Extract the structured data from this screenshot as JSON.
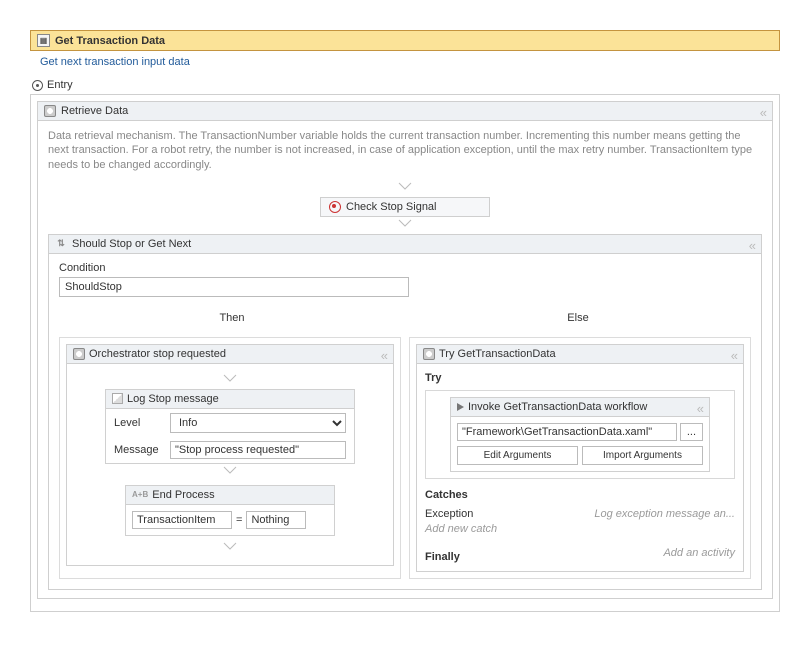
{
  "header": {
    "title": "Get Transaction Data",
    "subtitle": "Get next transaction input data"
  },
  "entry_label": "Entry",
  "retrieve": {
    "title": "Retrieve Data",
    "description": "Data retrieval mechanism. The TransactionNumber variable holds the current transaction number. Incrementing this number means getting the next transaction. For a robot retry, the number is not increased, in case of application exception, until the max retry number. TransactionItem type needs to be changed accordingly."
  },
  "check_stop": {
    "label": "Check Stop Signal"
  },
  "should_stop": {
    "title": "Should Stop or Get Next",
    "condition_label": "Condition",
    "condition_value": "ShouldStop",
    "then_label": "Then",
    "else_label": "Else"
  },
  "then_branch": {
    "title": "Orchestrator stop requested",
    "log": {
      "title": "Log Stop message",
      "level_label": "Level",
      "level_value": "Info",
      "message_label": "Message",
      "message_value": "\"Stop process requested\""
    },
    "assign": {
      "title": "End Process",
      "left": "TransactionItem",
      "op": "=",
      "right": "Nothing"
    }
  },
  "else_branch": {
    "title": "Try GetTransactionData",
    "try_label": "Try",
    "invoke": {
      "title": "Invoke GetTransactionData workflow",
      "path": "\"Framework\\GetTransactionData.xaml\"",
      "browse": "...",
      "edit_args": "Edit Arguments",
      "import_args": "Import Arguments"
    },
    "catches_label": "Catches",
    "exception_label": "Exception",
    "exception_action": "Log exception message an...",
    "add_catch": "Add new catch",
    "finally_label": "Finally",
    "finally_action": "Add an activity"
  }
}
